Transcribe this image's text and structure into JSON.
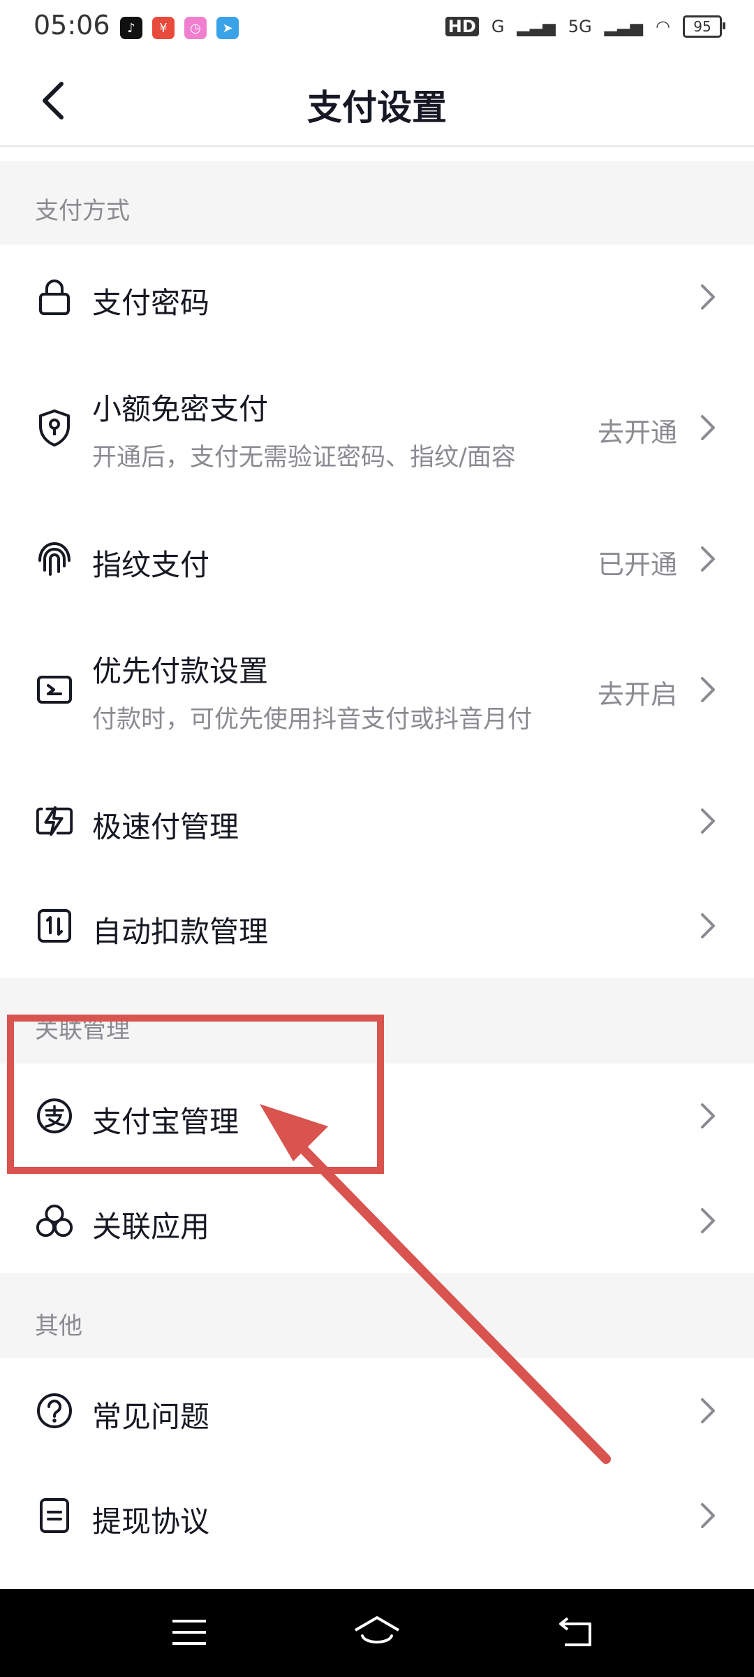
{
  "status_bar": {
    "time": "05:06",
    "app_icons": [
      "tiktok-icon",
      "coupon-app-icon",
      "clock-app-icon",
      "telegram-icon"
    ],
    "network_labels": [
      "HD",
      "G",
      "5G"
    ],
    "battery": "95"
  },
  "header": {
    "title": "支付设置"
  },
  "sections": {
    "payment_methods": "支付方式",
    "linked_management": "关联管理",
    "other": "其他"
  },
  "rows": {
    "password": {
      "title": "支付密码",
      "icon": "lock-icon"
    },
    "small_amount": {
      "title": "小额免密支付",
      "subtitle": "开通后，支付无需验证密码、指纹/面容",
      "status": "去开通",
      "icon": "shield-key-icon"
    },
    "fingerprint": {
      "title": "指纹支付",
      "status": "已开通",
      "icon": "fingerprint-icon"
    },
    "priority": {
      "title": "优先付款设置",
      "subtitle": "付款时，可优先使用抖音支付或抖音月付",
      "status": "去开启",
      "icon": "priority-pay-icon"
    },
    "fast_pay": {
      "title": "极速付管理",
      "icon": "lightning-card-icon"
    },
    "auto_debit": {
      "title": "自动扣款管理",
      "icon": "auto-debit-icon"
    },
    "alipay": {
      "title": "支付宝管理",
      "icon": "alipay-icon"
    },
    "linked_apps": {
      "title": "关联应用",
      "icon": "linked-apps-icon"
    },
    "faq": {
      "title": "常见问题",
      "icon": "question-icon"
    },
    "withdraw": {
      "title": "提现协议",
      "icon": "document-icon"
    }
  },
  "annotation": {
    "color": "#d9534f"
  },
  "colors": {
    "text_primary": "#161823",
    "text_secondary": "#8a8b91",
    "section_bg": "#f5f5f5"
  }
}
